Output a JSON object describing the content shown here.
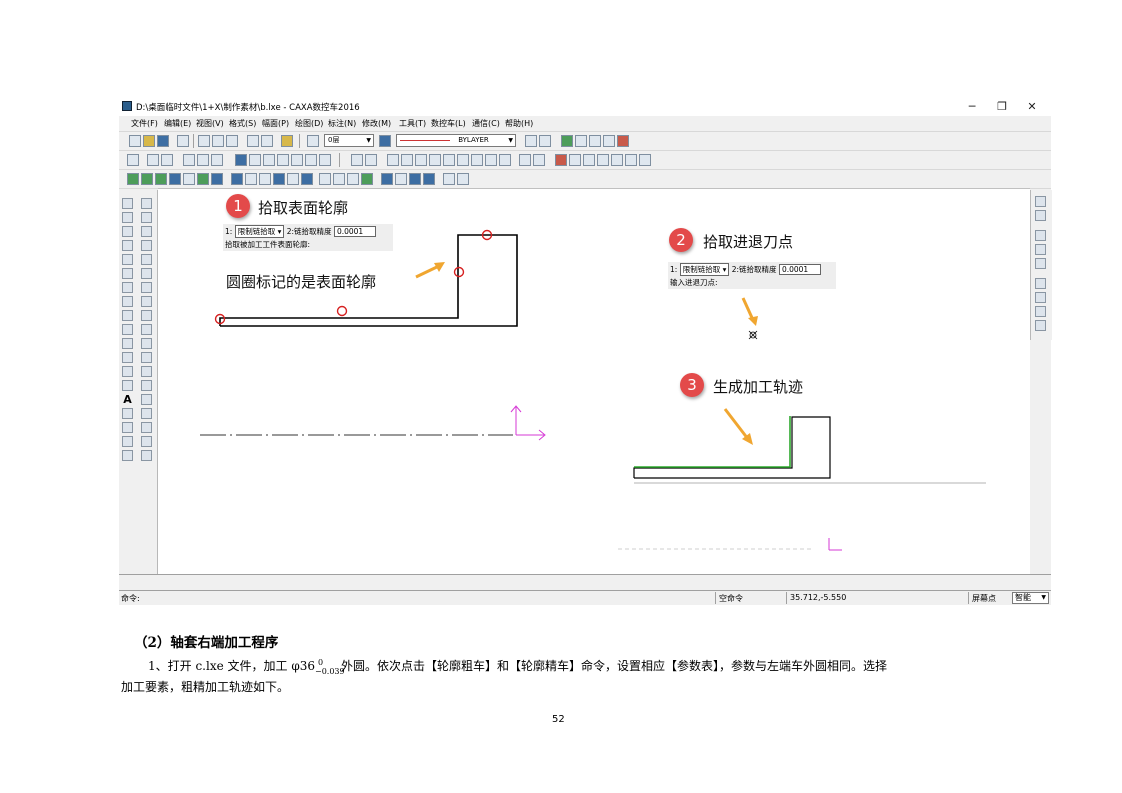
{
  "window": {
    "title": "D:\\桌面临时文件\\1+X\\制作素材\\b.lxe - CAXA数控车2016",
    "controls": [
      "─",
      "❐",
      "✕"
    ]
  },
  "menu": [
    "文件(F)",
    "编辑(E)",
    "视图(V)",
    "格式(S)",
    "幅面(P)",
    "绘图(D)",
    "标注(N)",
    "修改(M)",
    "工具(T)",
    "数控车(L)",
    "通信(C)",
    "帮助(H)"
  ],
  "toolbar": {
    "layer_value": "0层",
    "linetype_value": "BYLAYER"
  },
  "annotations": {
    "step1": {
      "num": "1",
      "text": "拾取表面轮廓"
    },
    "step1_note": "圆圈标记的是表面轮廓",
    "step2": {
      "num": "2",
      "text": "拾取进退刀点"
    },
    "step3": {
      "num": "3",
      "text": "生成加工轨迹"
    }
  },
  "prompt1": {
    "mode_prefix": "1:",
    "mode_value": "限制链拾取",
    "precision_label": "2:链拾取精度",
    "precision_value": "0.0001",
    "message": "拾取被加工工件表面轮廓:"
  },
  "prompt2": {
    "mode_prefix": "1:",
    "mode_value": "限制链拾取",
    "precision_label": "2:链拾取精度",
    "precision_value": "0.0001",
    "message": "输入进退刀点:"
  },
  "cmdline": {
    "text": ""
  },
  "status": {
    "command_label": "命令:",
    "state": "空命令",
    "coords": "35.712,-5.550",
    "snap_label": "屏幕点",
    "snap_mode": "智能"
  },
  "doc": {
    "section_title": "（2）轴套右端加工程序",
    "para1_a": "1、打开 c.lxe 文件，加工 φ36",
    "tol_upper": "0",
    "tol_lower": "−0.039",
    "para1_b": "外圆。依次点击【轮廓粗车】和【轮廓精车】命令，设置相应【参数表】，参数与左端车外圆相同。选择",
    "para2": "加工要素，粗精加工轨迹如下。",
    "page_number": "52"
  },
  "colors": {
    "annotation_red": "#e34a4a",
    "arrow_orange": "#f0a630",
    "pick_circle": "#d62020",
    "axis_magenta": "#d63ad6",
    "toolpath_green": "#2eaa2e"
  }
}
